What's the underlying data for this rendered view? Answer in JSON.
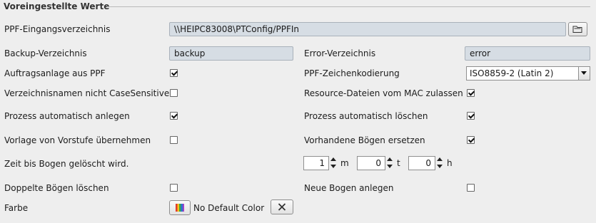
{
  "section": {
    "title": "Voreingestellte Werte"
  },
  "input_dir": {
    "label": "PPF-Eingangsverzeichnis",
    "value": "\\\\HEIPC83008\\PTConfig/PPFIn",
    "browse_icon": "folder-browse-icon"
  },
  "backup_dir": {
    "label": "Backup-Verzeichnis",
    "value": "backup"
  },
  "error_dir": {
    "label": "Error-Verzeichnis",
    "value": "error"
  },
  "order_creation": {
    "label": "Auftragsanlage aus PPF",
    "checked": true
  },
  "char_encoding": {
    "label": "PPF-Zeichenkodierung",
    "value": "ISO8859-2 (Latin 2)"
  },
  "case_sensitive": {
    "label": "Verzeichnisnamen nicht CaseSensitive",
    "checked": false
  },
  "mac_resource": {
    "label": "Resource-Dateien vom MAC zulassen",
    "checked": true
  },
  "auto_create": {
    "label": "Prozess automatisch anlegen",
    "checked": true
  },
  "auto_delete": {
    "label": "Prozess automatisch löschen",
    "checked": true
  },
  "template_prepress": {
    "label": "Vorlage von Vorstufe übernehmen",
    "checked": false
  },
  "replace_sheets": {
    "label": "Vorhandene Bögen ersetzen",
    "checked": true
  },
  "delete_time": {
    "label": "Zeit bis Bogen gelöscht wird.",
    "months": "1",
    "months_unit": "m",
    "days": "0",
    "days_unit": "t",
    "hours": "0",
    "hours_unit": "h"
  },
  "delete_duplicates": {
    "label": "Doppelte Bögen löschen",
    "checked": false
  },
  "new_sheet": {
    "label": "Neue Bogen anlegen",
    "checked": false
  },
  "color": {
    "label": "Farbe",
    "button_text": "No Default Color",
    "icon": "color-palette-icon",
    "clear_icon": "close-icon"
  }
}
